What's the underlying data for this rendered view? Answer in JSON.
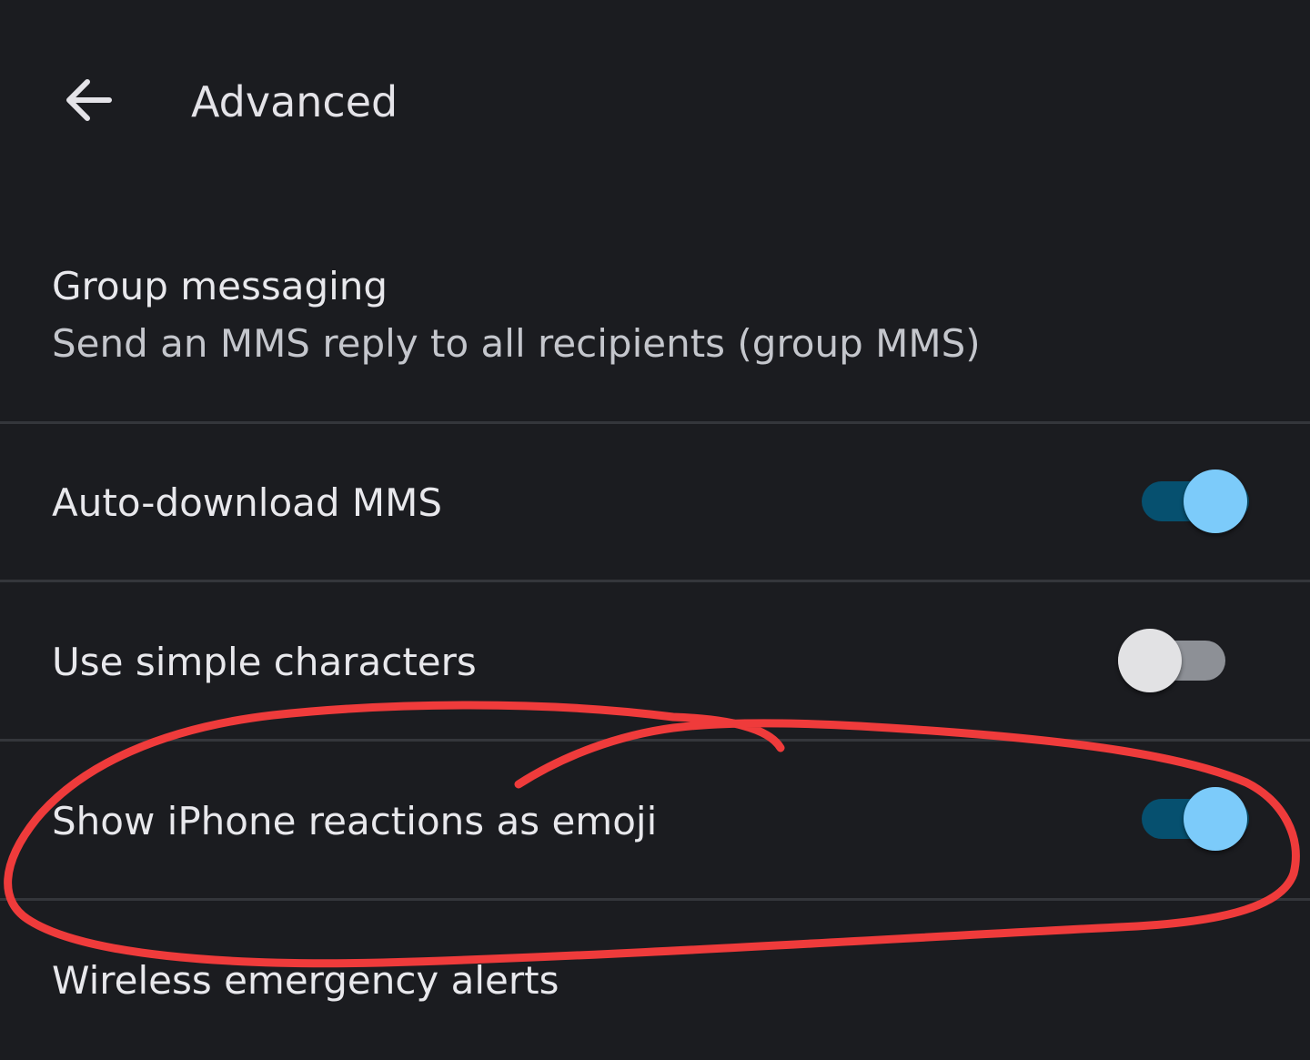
{
  "header": {
    "title": "Advanced",
    "back_icon": "arrow-back-icon"
  },
  "settings": [
    {
      "title": "Group messaging",
      "subtitle": "Send an MMS reply to all recipients (group MMS)"
    },
    {
      "title": "Auto-download MMS",
      "toggle": "on"
    },
    {
      "title": "Use simple characters",
      "toggle": "off"
    },
    {
      "title": "Show iPhone reactions as emoji",
      "toggle": "on",
      "circled": true
    },
    {
      "title": "Wireless emergency alerts"
    }
  ],
  "colors": {
    "background": "#1b1c20",
    "switch_on_track": "#06506f",
    "switch_on_thumb": "#7ccbfa",
    "switch_off_track": "#8d9096",
    "switch_off_thumb": "#e2e2e4",
    "annotation_stroke": "#ef3b3b"
  }
}
